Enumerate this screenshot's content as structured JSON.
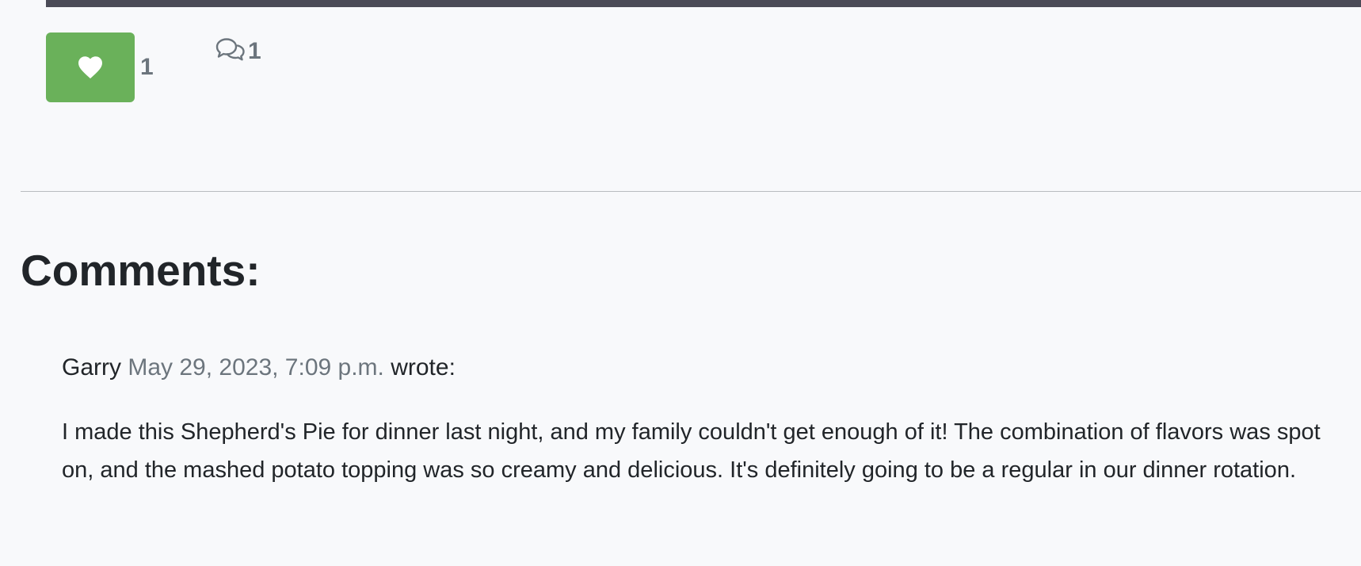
{
  "post": {
    "like_count": "1",
    "comment_count": "1",
    "colors": {
      "like_button": "#6ab15a",
      "count_text": "#6c757d",
      "top_strip": "#4b4b57"
    },
    "icons": {
      "like": "heart-icon",
      "comments": "speech-bubbles-icon"
    }
  },
  "comments_section": {
    "heading": "Comments:",
    "comments": [
      {
        "author": "Garry",
        "date": "May 29, 2023, 7:09 p.m.",
        "verb": "wrote:",
        "body": "I made this Shepherd's Pie for dinner last night, and my family couldn't get enough of it! The combination of flavors was spot on, and the mashed potato topping was so creamy and delicious. It's definitely going to be a regular in our dinner rotation."
      }
    ]
  }
}
